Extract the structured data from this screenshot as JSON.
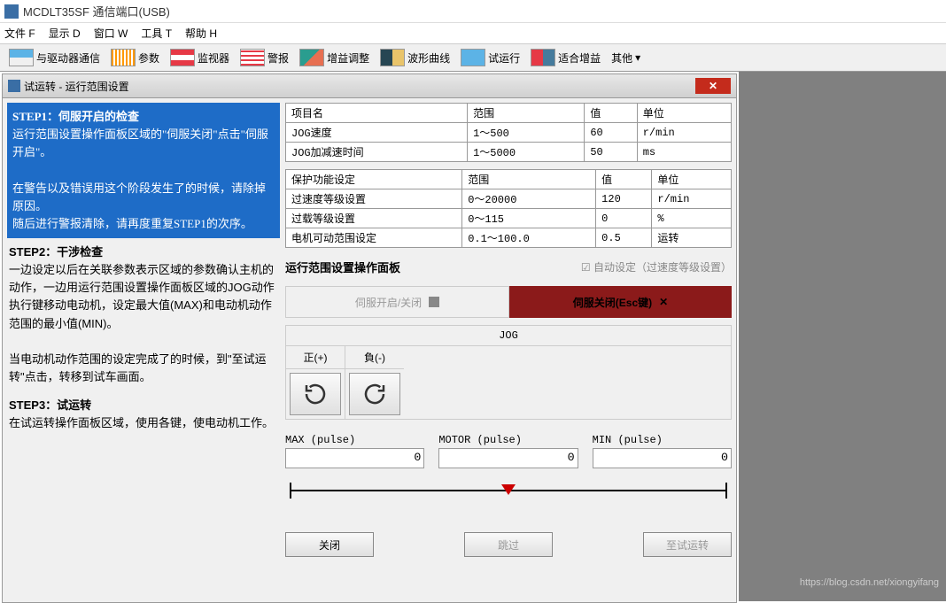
{
  "title": "MCDLT35SF  通信端口(USB)",
  "menu": {
    "file": "文件 F",
    "display": "显示 D",
    "window": "窗口 W",
    "tools": "工具 T",
    "help": "帮助 H"
  },
  "toolbar": {
    "comm": "与驱动器通信",
    "param": "参数",
    "monitor": "监视器",
    "alarm": "警报",
    "gain": "增益调整",
    "wave": "波形曲线",
    "trial": "试运行",
    "fitgain": "适合增益",
    "other": "其他"
  },
  "dialog_title": "试运转 - 运行范围设置",
  "steps": {
    "s1_title": "STEP1：伺服开启的检查",
    "s1_body1": "运行范围设置操作面板区域的\"伺服关闭\"点击\"伺服开启\"。",
    "s1_body2": "在警告以及错误用这个阶段发生了的时候，请除掉原因。\n随后进行警报清除，请再度重复STEP1的次序。",
    "s2_title": "STEP2：干涉检查",
    "s2_body1": "一边设定以后在关联参数表示区域的参数确认主机的动作，一边用运行范围设置操作面板区域的JOG动作执行键移动电动机，设定最大值(MAX)和电动机动作范围的最小值(MIN)。",
    "s2_body2": "当电动机动作范围的设定完成了的时候，到\"至试运转\"点击，转移到试车画面。",
    "s3_title": "STEP3：试运转",
    "s3_body": "在试运转操作面板区域，使用各键，使电动机工作。"
  },
  "table1": {
    "h1": "项目名",
    "h2": "范围",
    "h3": "值",
    "h4": "单位",
    "r1c1": "JOG速度",
    "r1c2": "1～500",
    "r1c3": "60",
    "r1c4": "r/min",
    "r2c1": "JOG加减速时间",
    "r2c2": "1～5000",
    "r2c3": "50",
    "r2c4": "ms"
  },
  "table2": {
    "h1": "保护功能设定",
    "h2": "范围",
    "h3": "值",
    "h4": "单位",
    "r1c1": "过速度等级设置",
    "r1c2": "0～20000",
    "r1c3": "120",
    "r1c4": "r/min",
    "r2c1": "过载等级设置",
    "r2c2": "0～115",
    "r2c3": "0",
    "r2c4": "%",
    "r3c1": "电机可动范围设定",
    "r3c2": "0.1～100.0",
    "r3c3": "0.5",
    "r3c4": "运转"
  },
  "panel": {
    "title": "运行范围设置操作面板",
    "auto": "自动设定（过速度等级设置）",
    "servo_on": "伺服开启/关闭",
    "servo_off": "伺服关闭(Esc键)",
    "jog": "JOG",
    "jog_pos": "正(+)",
    "jog_neg": "負(-)",
    "max_label": "MAX (pulse)",
    "motor_label": "MOTOR (pulse)",
    "min_label": "MIN (pulse)",
    "max_val": "0",
    "motor_val": "0",
    "min_val": "0",
    "btn_close": "关闭",
    "btn_skip": "跳过",
    "btn_trial": "至试运转"
  },
  "watermark": "https://blog.csdn.net/xiongyifang"
}
